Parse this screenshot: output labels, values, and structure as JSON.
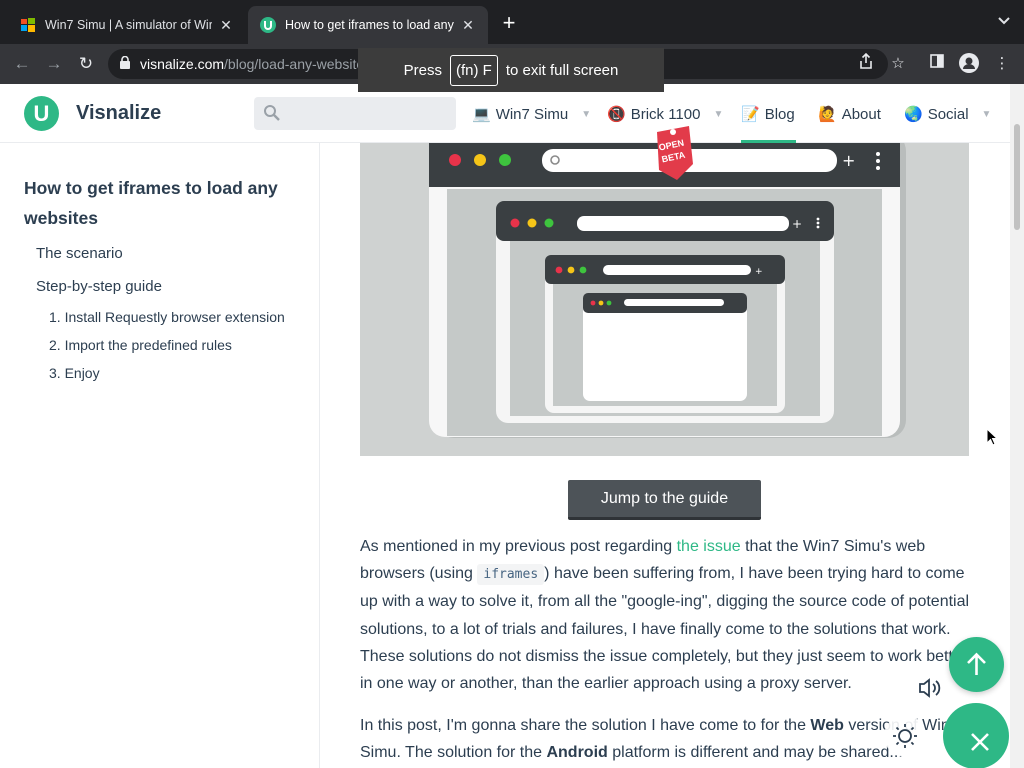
{
  "browser": {
    "tabs": [
      {
        "title": "Win7 Simu | A simulator of Wir",
        "active": false,
        "favicon": "win7-icon"
      },
      {
        "title": "How to get iframes to load any",
        "active": true,
        "favicon": "visnalize-icon"
      }
    ],
    "new_tab": "+",
    "url_host": "visnalize.com",
    "url_path": "/blog/load-any-websites-in-iframes"
  },
  "fullscreen_toast": {
    "prefix": "Press",
    "key": "(fn) F",
    "suffix": "to exit full screen"
  },
  "site": {
    "name": "Visnalize",
    "logo_letter": "U",
    "search_placeholder": "",
    "nav": [
      {
        "label": "Win7 Simu",
        "icon": "laptop-icon",
        "has_dropdown": true
      },
      {
        "label": "Brick 1100",
        "icon": "brick-icon",
        "has_dropdown": true
      },
      {
        "label": "Blog",
        "icon": "memo-icon",
        "has_dropdown": false,
        "active": true
      },
      {
        "label": "About",
        "icon": "person-icon",
        "has_dropdown": false
      },
      {
        "label": "Social",
        "icon": "globe-icon",
        "has_dropdown": true
      }
    ],
    "accent_color": "#2eb886"
  },
  "sidebar": {
    "heading": "How to get iframes to load any websites",
    "toc": [
      {
        "label": "The scenario",
        "level": 1
      },
      {
        "label": "Step-by-step guide",
        "level": 1
      },
      {
        "label": "1. Install Requestly browser extension",
        "level": 2
      },
      {
        "label": "2. Import the predefined rules",
        "level": 2
      },
      {
        "label": "3. Enjoy",
        "level": 2
      }
    ]
  },
  "content": {
    "beta_badge": {
      "line1": "OPEN",
      "line2": "BETA"
    },
    "jump_button": "Jump to the guide",
    "p1": {
      "before_link": "As mentioned in my previous post regarding ",
      "link": "the issue",
      "after_link": " that the Win7 Simu's web browsers (using ",
      "code": "iframes",
      "rest": ") have been suffering from, I have been trying hard to come up with a way to solve it, from all the \"google-ing\", digging the source code of potential solutions, to a lot of trials and failures, I have finally come to the solutions that work. These solutions do not dismiss the issue completely, but they just seem to work better, in one way or another, than the earlier approach using a proxy server."
    },
    "p2": {
      "a": "In this post, I'm gonna share the solution I have come to for the ",
      "b1": "Web",
      "c": " version of Win7 Simu. The solution for the ",
      "b2": "Android",
      "d": " platform is different and may be shared..."
    }
  }
}
